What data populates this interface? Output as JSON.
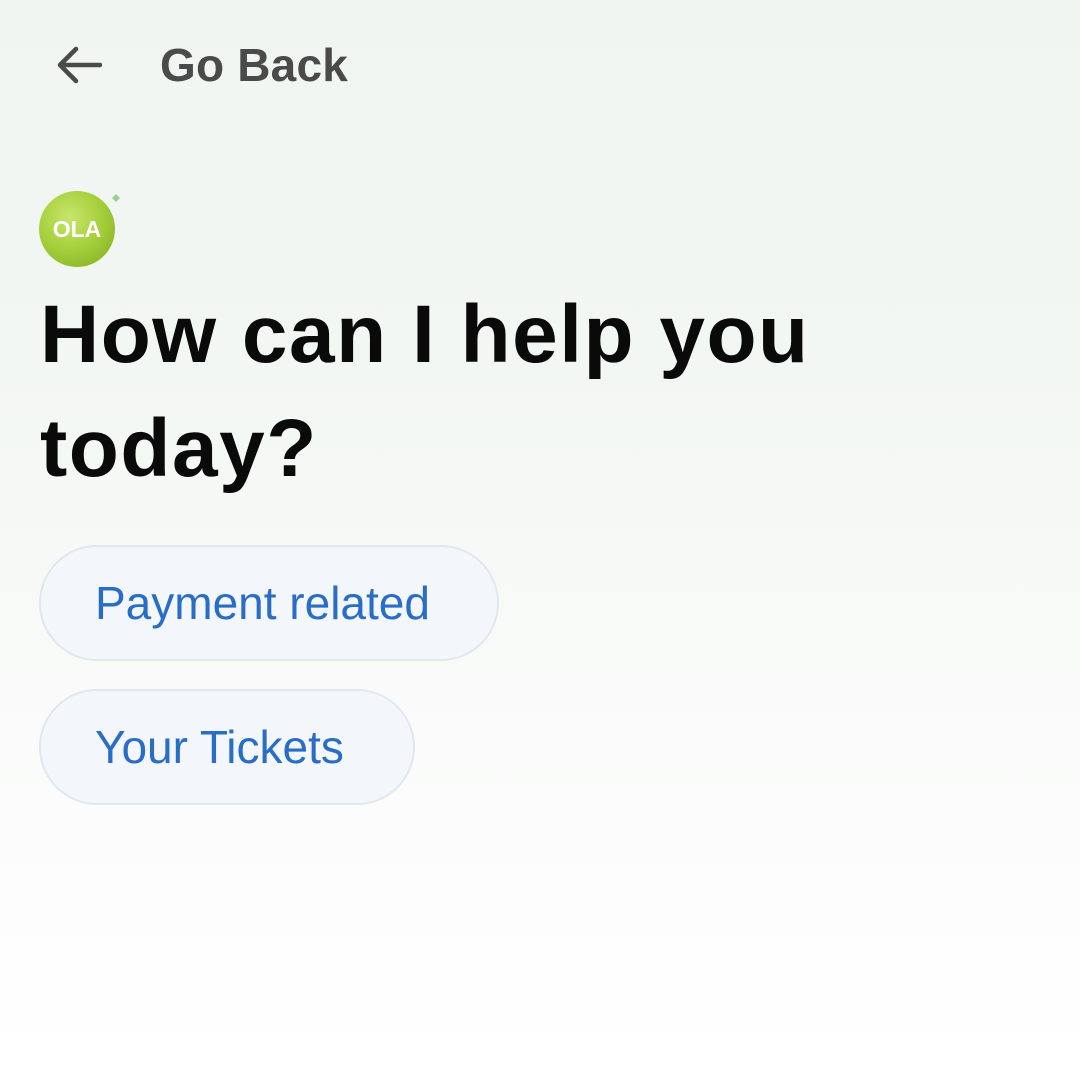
{
  "header": {
    "back_label": "Go Back",
    "back_icon": "arrow-left-icon"
  },
  "logo": {
    "text": "OLA",
    "icon": "ola-logo-icon",
    "colors": {
      "ball": "#a6cf3c",
      "sparkle": "#9fd08a"
    }
  },
  "main": {
    "heading": "How can I help you today?",
    "options": [
      {
        "label": "Payment related"
      },
      {
        "label": "Your Tickets"
      }
    ]
  },
  "colors": {
    "heading_text": "#0a0a0a",
    "back_text": "#4a4a4a",
    "chip_text": "#2a6dc5",
    "chip_background": "#f3f7fc",
    "chip_border": "#e1e7ef"
  }
}
